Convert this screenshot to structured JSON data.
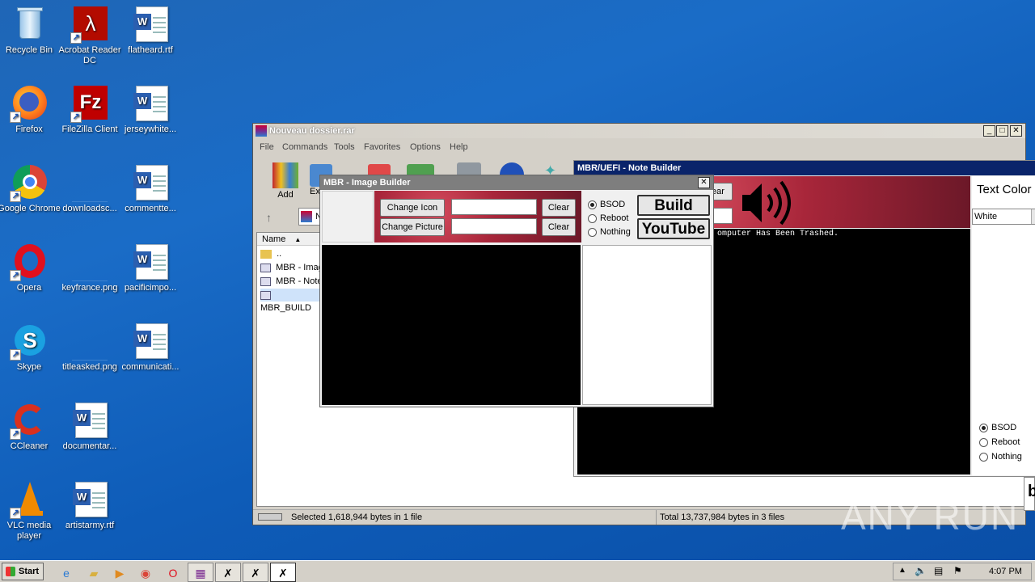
{
  "desktop": {
    "icons": [
      {
        "label": "Recycle Bin"
      },
      {
        "label": "Acrobat Reader DC"
      },
      {
        "label": "flatheard.rtf"
      },
      {
        "label": "Firefox"
      },
      {
        "label": "FileZilla Client"
      },
      {
        "label": "jerseywhite..."
      },
      {
        "label": "Google Chrome"
      },
      {
        "label": "downloadsc..."
      },
      {
        "label": "commentte..."
      },
      {
        "label": "Opera"
      },
      {
        "label": "keyfrance.png"
      },
      {
        "label": "pacificimpo..."
      },
      {
        "label": "Skype"
      },
      {
        "label": "titleasked.png"
      },
      {
        "label": "communicati..."
      },
      {
        "label": "CCleaner"
      },
      {
        "label": "documentar..."
      },
      {
        "label": "VLC media player"
      },
      {
        "label": "artistarmy.rtf"
      }
    ],
    "watermark": "ANY RUN"
  },
  "winrar": {
    "title": "Nouveau dossier.rar",
    "menu": [
      "File",
      "Commands",
      "Tools",
      "Favorites",
      "Options",
      "Help"
    ],
    "toolbar": {
      "add": "Add",
      "extract_partial": "Ex"
    },
    "column_name": "Name",
    "files": [
      {
        "name": ".."
      },
      {
        "name": "MBR - Image"
      },
      {
        "name": "MBR - Note"
      },
      {
        "name": "MBR_BUILD"
      }
    ],
    "path_partial": "N",
    "status_left": "Selected 1,618,944 bytes in 1 file",
    "status_right": "Total 13,737,984 bytes in 3 files"
  },
  "note_builder": {
    "title": "MBR/UEFI - Note Builder",
    "clear_partial": "ear",
    "preview_text": "omputer Has Been Trashed.",
    "text_color_label": "Text Color",
    "text_color_value": "White",
    "options": [
      {
        "label": "BSOD",
        "selected": true
      },
      {
        "label": "Reboot",
        "selected": false
      },
      {
        "label": "Nothing",
        "selected": false
      }
    ],
    "partial_button": "b"
  },
  "image_builder": {
    "title": "MBR - Image Builder",
    "change_icon": "Change Icon",
    "change_picture": "Change Picture",
    "clear_1": "Clear",
    "clear_2": "Clear",
    "icon_path": "",
    "picture_path": "",
    "options": [
      {
        "label": "BSOD",
        "selected": true
      },
      {
        "label": "Reboot",
        "selected": false
      },
      {
        "label": "Nothing",
        "selected": false
      }
    ],
    "build": "Build",
    "youtube": "YouTube"
  },
  "taskbar": {
    "start": "Start",
    "clock": "4:07 PM"
  },
  "colors": {
    "desktop_blue": "#1a6cc7",
    "titlebar_blue": "#0a246a",
    "art_red": "#a8263a"
  }
}
